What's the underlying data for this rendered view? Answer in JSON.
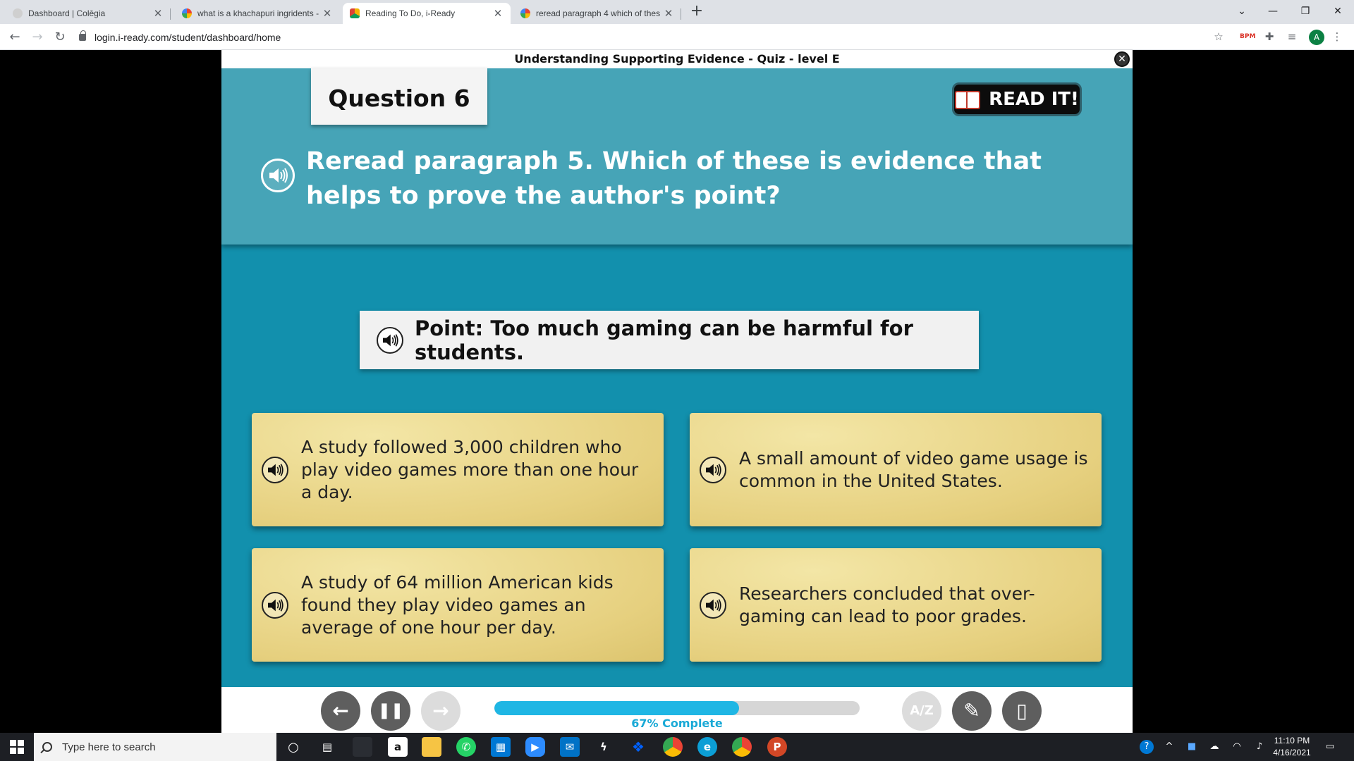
{
  "browser": {
    "tabs": [
      {
        "label": "Dashboard | Colēgia",
        "active": false
      },
      {
        "label": "what is a khachapuri ingridents -",
        "active": false
      },
      {
        "label": "Reading To Do, i-Ready",
        "active": true
      },
      {
        "label": "reread paragraph 4 which of thes",
        "active": false
      }
    ],
    "new_tab_label": "+",
    "url": "login.i-ready.com/student/dashboard/home",
    "profile_initial": "A"
  },
  "app": {
    "title": "Understanding Supporting Evidence - Quiz - level E",
    "close_label": "✕",
    "question_number": "Question 6",
    "read_it_label": "READ IT!",
    "question_text": "Reread paragraph 5. Which of these is evidence that helps to prove the author's point?",
    "point_text": "Point: Too much gaming can be harmful for students.",
    "answers": [
      {
        "text": "A study followed 3,000 children who play video games more than one hour a day."
      },
      {
        "text": "A small amount of video game usage is common in the United States."
      },
      {
        "text": "A study of 64 million American kids found they play video games an average of one hour per day."
      },
      {
        "text": "Researchers concluded that over-gaming can lead to poor grades."
      }
    ],
    "controls": {
      "back_label": "←",
      "pause_label": "❚❚",
      "forward_label": "→",
      "glossary_label": "A/Z",
      "pencil_label": "✎",
      "clipboard_label": "▯"
    },
    "progress": {
      "percent": 67,
      "label": "67% Complete"
    }
  },
  "taskbar": {
    "search_placeholder": "Type here to search",
    "time": "11:10 PM",
    "date": "4/16/2021"
  },
  "colors": {
    "app_background": "#1290ad",
    "question_panel": "#46a4b7",
    "progress_fill": "#1fb6e4",
    "answer_card": "#e6d07f"
  }
}
